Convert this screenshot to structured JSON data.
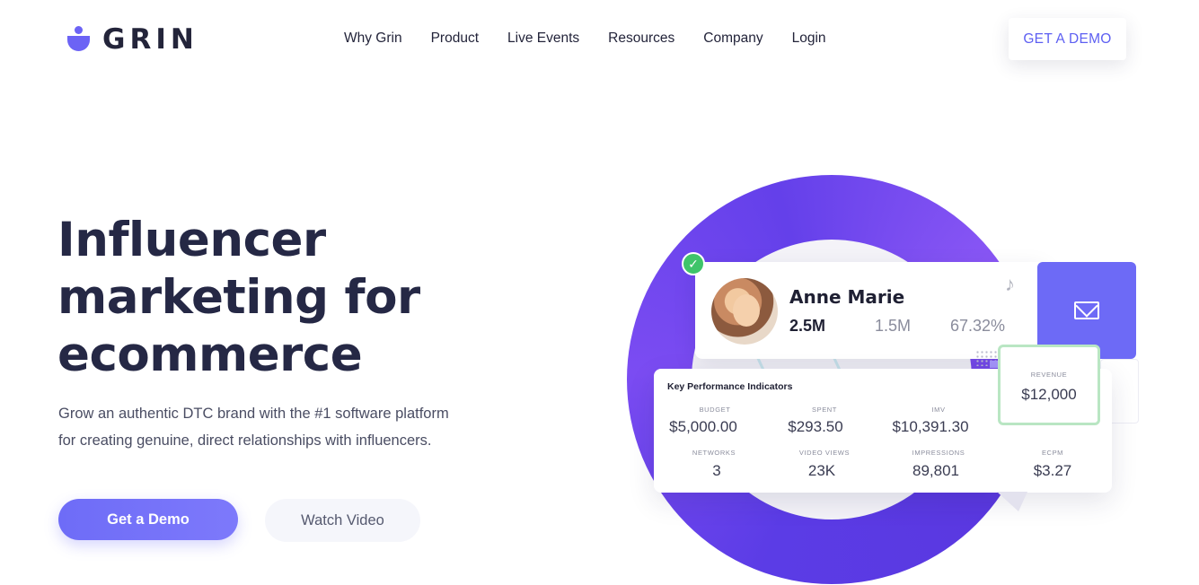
{
  "brand": {
    "name": "GRIN",
    "accent": "#6c63f5"
  },
  "nav": {
    "items": [
      "Why Grin",
      "Product",
      "Live Events",
      "Resources",
      "Company",
      "Login"
    ],
    "cta": "GET A DEMO"
  },
  "hero": {
    "title_lines": [
      "Influencer",
      "marketing for",
      "ecommerce"
    ],
    "subtitle_lines": [
      "Grow an authentic DTC brand with the #1 software platform",
      "for creating genuine, direct relationships with influencers."
    ],
    "primary_button": "Get a Demo",
    "secondary_button": "Watch Video"
  },
  "profile": {
    "name": "Anne Marie",
    "stats": [
      "2.5M",
      "1.5M",
      "67.32%"
    ]
  },
  "kpi": {
    "title": "Key Performance Indicators",
    "row1": [
      {
        "label": "BUDGET",
        "value": "$5,000.00"
      },
      {
        "label": "SPENT",
        "value": "$293.50"
      },
      {
        "label": "IMV",
        "value": "$10,391.30"
      }
    ],
    "row2": [
      {
        "label": "NETWORKS",
        "value": "3"
      },
      {
        "label": "VIDEO VIEWS",
        "value": "23K"
      },
      {
        "label": "IMPRESSIONS",
        "value": "89,801"
      },
      {
        "label": "ECPM",
        "value": "$3.27"
      }
    ],
    "revenue": {
      "label": "REVENUE",
      "value": "$12,000"
    }
  }
}
